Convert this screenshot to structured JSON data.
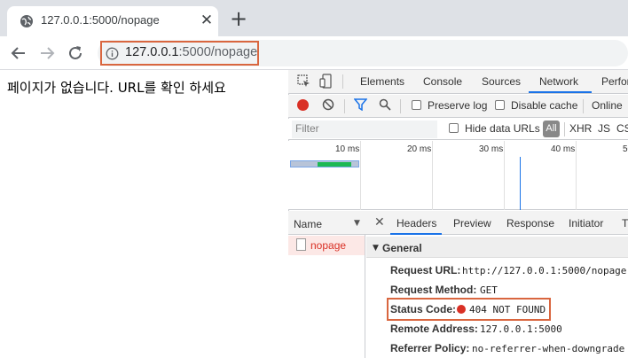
{
  "tab": {
    "title": "127.0.0.1:5000/nopage",
    "close": "✕",
    "new_tab": "+"
  },
  "address_bar": {
    "host": "127.0.0.1",
    "path": ":5000/nopage"
  },
  "page": {
    "message": "페이지가 없습니다. URL를 확인 하세요"
  },
  "devtools": {
    "tabs": [
      "Elements",
      "Console",
      "Sources",
      "Network",
      "Perfor"
    ],
    "active_tab": "Network",
    "controls": {
      "preserve_log": "Preserve log",
      "disable_cache": "Disable cache",
      "online": "Online"
    },
    "filter": {
      "placeholder": "Filter",
      "hide_data_urls": "Hide data URLs",
      "all": "All",
      "types": [
        "XHR",
        "JS",
        "CS"
      ]
    },
    "timeline": {
      "ticks": [
        "10 ms",
        "20 ms",
        "30 ms",
        "40 ms",
        "50"
      ]
    },
    "requests": {
      "column_header": "Name",
      "items": [
        "nopage"
      ]
    },
    "details": {
      "tabs": [
        "Headers",
        "Preview",
        "Response",
        "Initiator",
        "T"
      ],
      "active_tab": "Headers",
      "section": "General",
      "rows": [
        {
          "key": "Request URL:",
          "value": "http://127.0.0.1:5000/nopage"
        },
        {
          "key": "Request Method:",
          "value": "GET"
        },
        {
          "key": "Status Code:",
          "value": "404 NOT FOUND"
        },
        {
          "key": "Remote Address:",
          "value": "127.0.0.1:5000"
        },
        {
          "key": "Referrer Policy:",
          "value": "no-referrer-when-downgrade"
        }
      ]
    }
  },
  "colors": {
    "highlight": "#d9663f",
    "error_red": "#d93025",
    "accent_blue": "#1a73e8"
  }
}
